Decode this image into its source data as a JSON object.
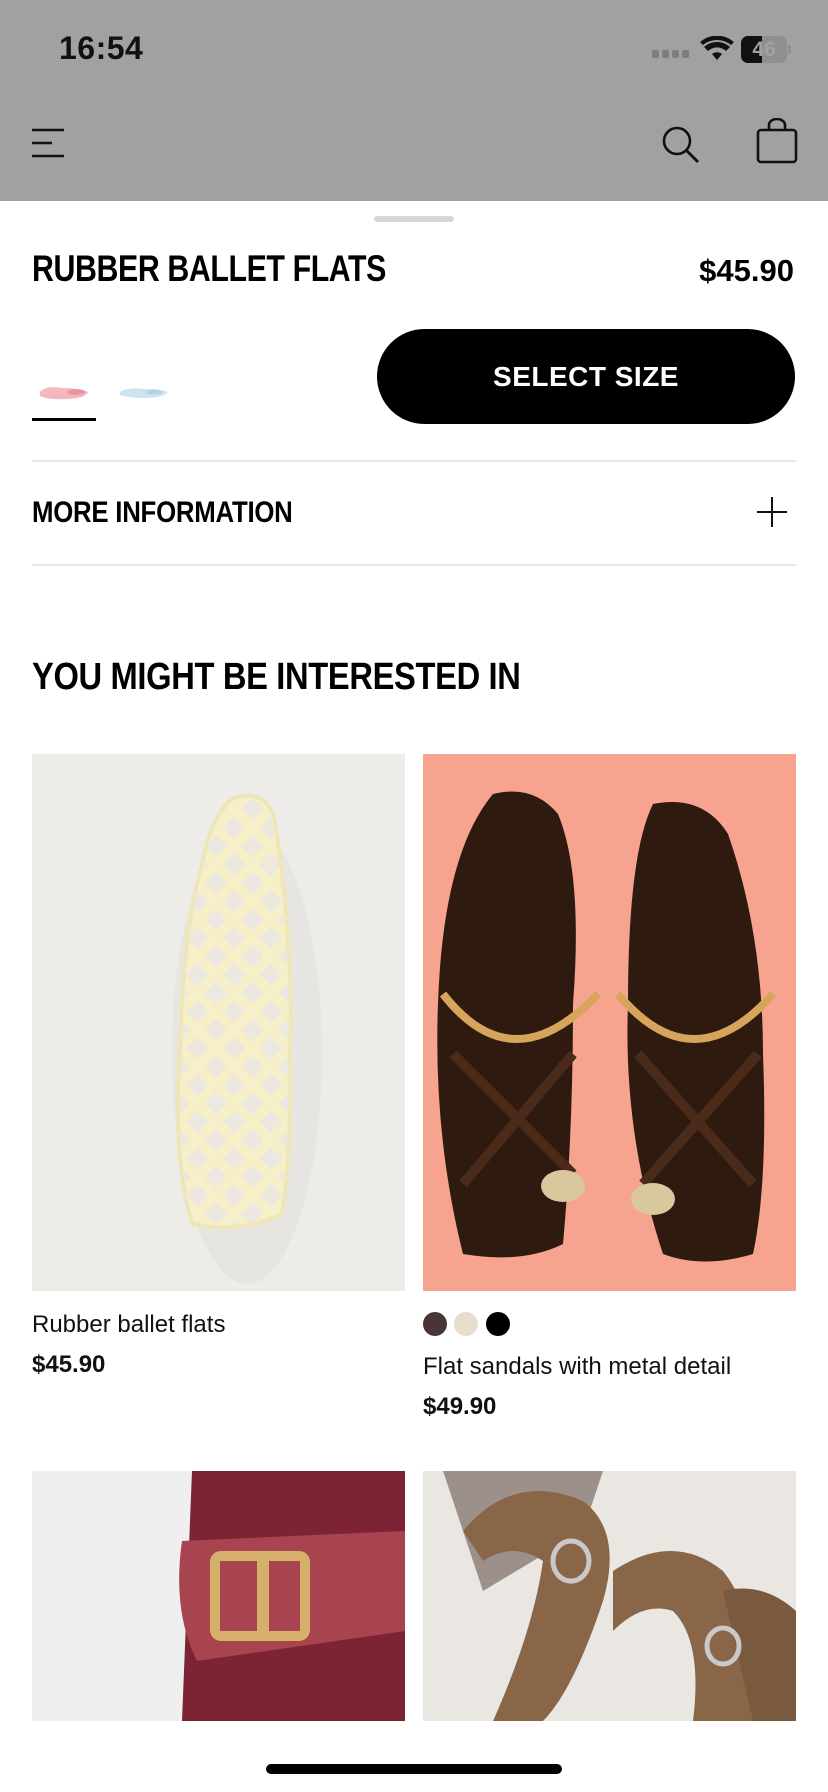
{
  "status_bar": {
    "time": "16:54",
    "battery": "46"
  },
  "product": {
    "title": "RUBBER BALLET FLATS",
    "price": "$45.90",
    "select_size_label": "SELECT SIZE",
    "color_swatches": [
      {
        "color": "#f2b7bf",
        "selected": true
      },
      {
        "color": "#cfe2f0",
        "selected": false
      }
    ],
    "more_info_label": "MORE INFORMATION"
  },
  "recommendations": {
    "heading": "YOU MIGHT BE INTERESTED IN",
    "items": [
      {
        "name": "Rubber ballet flats",
        "price": "$45.90",
        "image": "clear-mesh-ballet-flat"
      },
      {
        "name": "Flat sandals with metal detail",
        "price": "$49.90",
        "image": "brown-strappy-sandals",
        "colors": [
          "#4a3536",
          "#e8dccb",
          "#000000"
        ]
      },
      {
        "name": "",
        "price": "",
        "image": "burgundy-buckle-sandal"
      },
      {
        "name": "",
        "price": "",
        "image": "brown-suede-strap-sandal"
      }
    ]
  },
  "colors": {
    "sheet_bg": "#ffffff",
    "dim_bg": "#a1a1a1",
    "button_bg": "#000000"
  }
}
